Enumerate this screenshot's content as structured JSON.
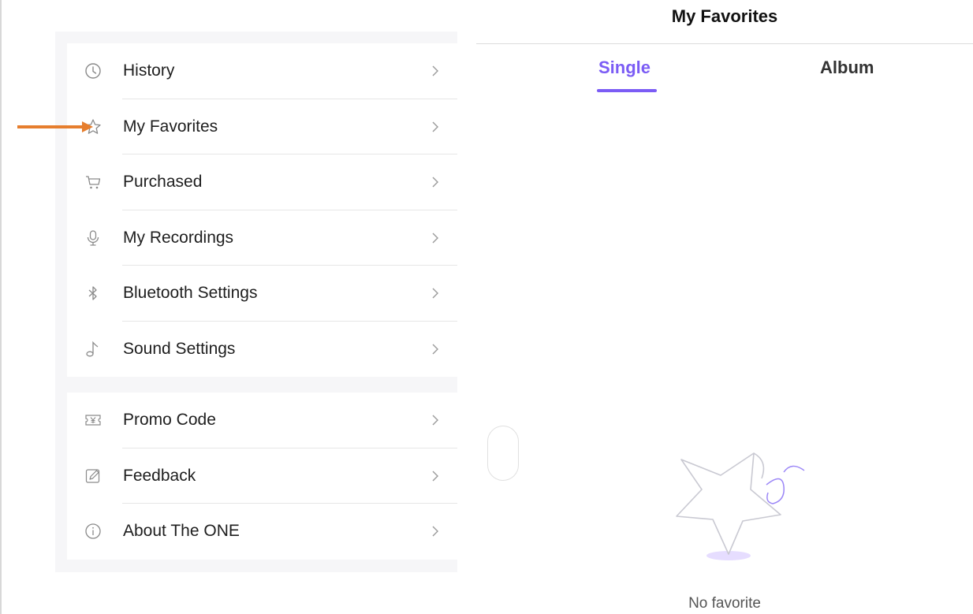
{
  "sidebar": {
    "group1": [
      {
        "label": "History",
        "icon": "clock-icon"
      },
      {
        "label": "My Favorites",
        "icon": "star-icon"
      },
      {
        "label": "Purchased",
        "icon": "cart-icon"
      },
      {
        "label": "My Recordings",
        "icon": "microphone-icon"
      },
      {
        "label": "Bluetooth Settings",
        "icon": "bluetooth-icon"
      },
      {
        "label": "Sound Settings",
        "icon": "music-note-icon"
      }
    ],
    "group2": [
      {
        "label": "Promo Code",
        "icon": "ticket-icon"
      },
      {
        "label": "Feedback",
        "icon": "edit-icon"
      },
      {
        "label": "About The ONE",
        "icon": "info-icon"
      }
    ]
  },
  "favorites": {
    "title": "My Favorites",
    "tabs": [
      {
        "label": "Single",
        "active": true
      },
      {
        "label": "Album",
        "active": false
      }
    ],
    "empty_message": "No favorite"
  },
  "colors": {
    "accent": "#7b5cf5",
    "annotation_arrow": "#e67e2e"
  }
}
